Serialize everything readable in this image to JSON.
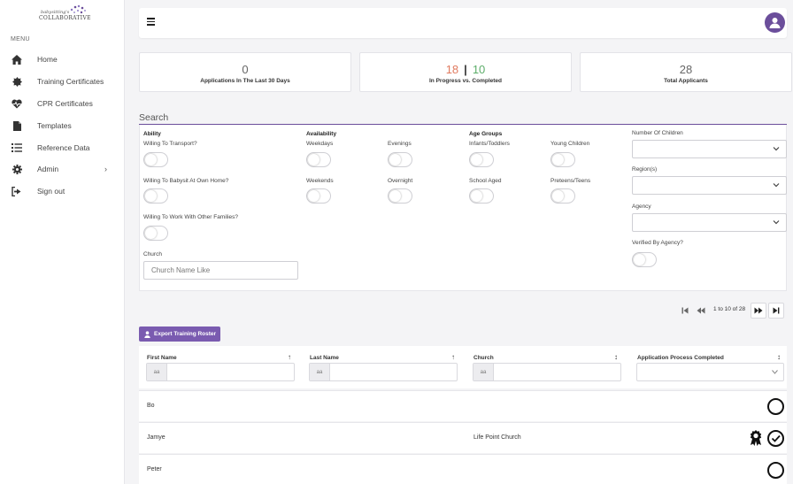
{
  "brand": {
    "logo_line1": "babysitting's",
    "logo_line2": "COLLABORATIVE",
    "accent": "#6b4e9b"
  },
  "sidebar": {
    "menu_label": "MENU",
    "items": [
      {
        "label": "Home",
        "icon": "home-icon"
      },
      {
        "label": "Training Certificates",
        "icon": "certificate-icon"
      },
      {
        "label": "CPR Certificates",
        "icon": "heartbeat-icon"
      },
      {
        "label": "Templates",
        "icon": "file-icon"
      },
      {
        "label": "Reference Data",
        "icon": "list-icon"
      },
      {
        "label": "Admin",
        "icon": "gear-icon"
      },
      {
        "label": "Sign out",
        "icon": "sign-out-icon"
      }
    ],
    "admin_chevron": "›"
  },
  "stats": {
    "applications_30_days": {
      "value": "0",
      "caption": "Applications In The Last 30 Days"
    },
    "progress": {
      "in_progress": "18",
      "separator": "|",
      "completed": "10",
      "caption": "In Progress vs. Completed"
    },
    "total": {
      "value": "28",
      "caption": "Total Applicants"
    }
  },
  "search": {
    "title": "Search",
    "ability": {
      "heading": "Ability",
      "transport": "Willing To Transport?",
      "babysit_home": "Willing To Babysit At Own Home?",
      "other_families": "Willing To Work With Other Families?"
    },
    "availability": {
      "heading": "Availability",
      "weekdays": "Weekdays",
      "evenings": "Evenings",
      "weekends": "Weekends",
      "overnight": "Overnight"
    },
    "age_groups": {
      "heading": "Age Groups",
      "infants": "Infants/Toddlers",
      "young_children": "Young Children",
      "school_aged": "School Aged",
      "preteens": "Preteens/Teens"
    },
    "church": {
      "label": "Church",
      "placeholder": "Church Name Like"
    },
    "number_of_children": {
      "label": "Number Of Children"
    },
    "regions": {
      "label": "Region(s)"
    },
    "agency": {
      "label": "Agency"
    },
    "verified": {
      "label": "Verified By Agency?"
    }
  },
  "pagination": {
    "text": "1 to 10 of 28"
  },
  "export": {
    "label": "Export Training Roster"
  },
  "table": {
    "columns": [
      {
        "label": "First Name",
        "sort": "↑"
      },
      {
        "label": "Last Name",
        "sort": "↑"
      },
      {
        "label": "Church",
        "sort": "↕"
      },
      {
        "label": "Application Process Completed",
        "sort": "↕"
      }
    ],
    "filter_prefix": "aa",
    "rows": [
      {
        "first_name": "Bo",
        "last_name": "",
        "church": "",
        "completed": false,
        "award": false
      },
      {
        "first_name": "Jamye",
        "last_name": "",
        "church": "Life Point Church",
        "completed": true,
        "award": true
      },
      {
        "first_name": "Peter",
        "last_name": "",
        "church": "",
        "completed": false,
        "award": false
      }
    ]
  }
}
